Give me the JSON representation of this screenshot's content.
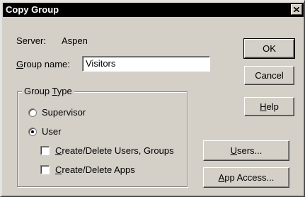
{
  "window": {
    "title": "Copy Group",
    "close_icon": "close-x-icon"
  },
  "server": {
    "label": "Server:",
    "value": "Aspen"
  },
  "group_name": {
    "label_prefix": "",
    "label_underlined": "G",
    "label_rest": "roup name:",
    "value": "Visitors"
  },
  "group_type": {
    "title_prefix": "Group ",
    "title_underlined": "T",
    "title_rest": "ype",
    "options": [
      {
        "label": "Supervisor",
        "selected": false
      },
      {
        "label": "User",
        "selected": true
      }
    ],
    "checkboxes": [
      {
        "underlined": "C",
        "rest": "reate/Delete Users, Groups",
        "checked": false
      },
      {
        "underlined": "C",
        "rest": "reate/Delete Apps",
        "checked": false
      }
    ]
  },
  "buttons": {
    "ok": "OK",
    "cancel": "Cancel",
    "help_underlined": "H",
    "help_rest": "elp",
    "users_underlined": "U",
    "users_rest": "sers...",
    "app_access_underlined": "A",
    "app_access_rest": "pp Access..."
  }
}
